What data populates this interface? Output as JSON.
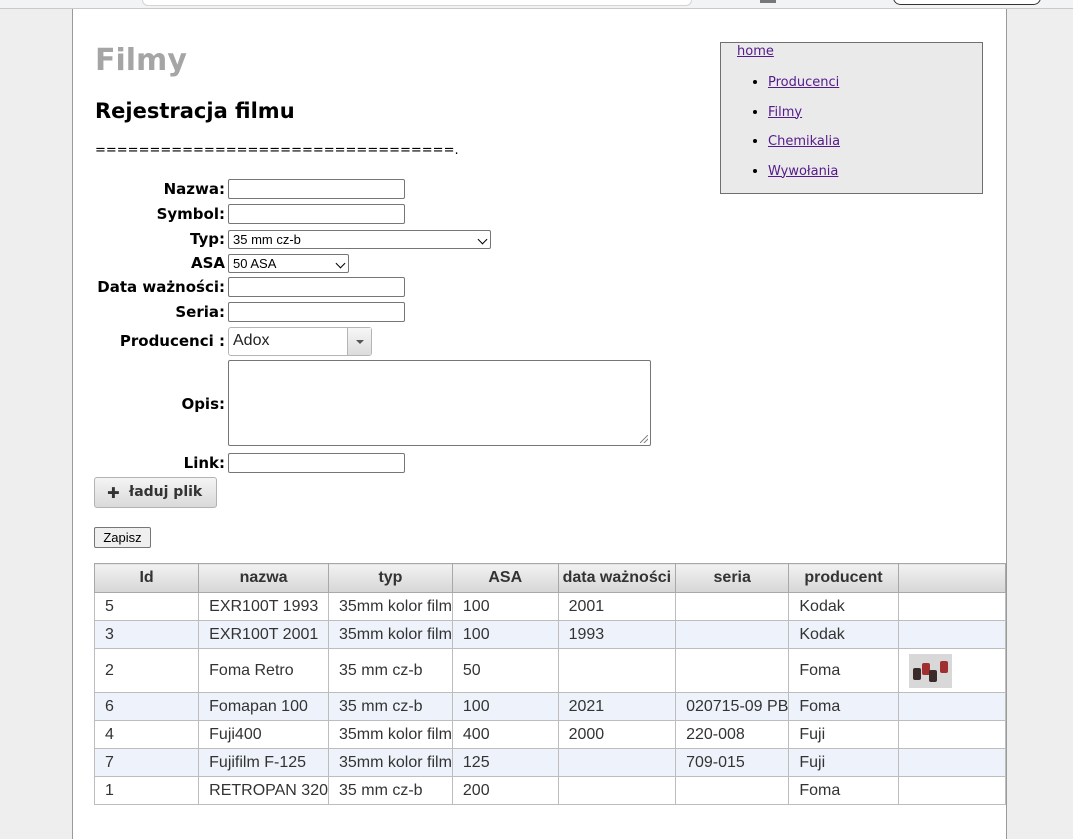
{
  "site_title": "Filmy",
  "form_title": "Rejestracja filmu",
  "separator": "=================================.",
  "nav": {
    "home": "home",
    "items": [
      {
        "label": "Producenci"
      },
      {
        "label": "Filmy"
      },
      {
        "label": "Chemikalia"
      },
      {
        "label": "Wywołania"
      }
    ]
  },
  "form": {
    "nazwa_label": "Nazwa:",
    "symbol_label": "Symbol:",
    "typ_label": "Typ:",
    "typ_value": "35 mm cz-b",
    "asa_label": "ASA",
    "asa_value": "50 ASA",
    "data_label": "Data ważności:",
    "seria_label": "Seria:",
    "producenci_label": "Producenci :",
    "producenci_value": "Adox",
    "opis_label": "Opis:",
    "link_label": "Link:",
    "upload_label": "ładuj plik",
    "submit_label": "Zapisz"
  },
  "table": {
    "headers": [
      "Id",
      "nazwa",
      "typ",
      "ASA",
      "data ważności",
      "seria",
      "producent",
      ""
    ],
    "rows": [
      {
        "id": "5",
        "nazwa": "EXR100T 1993",
        "typ": "35mm kolor film",
        "asa": "100",
        "data": "2001",
        "seria": "",
        "producent": "Kodak",
        "thumb": false
      },
      {
        "id": "3",
        "nazwa": "EXR100T 2001",
        "typ": "35mm kolor film",
        "asa": "100",
        "data": "1993",
        "seria": "",
        "producent": "Kodak",
        "thumb": false
      },
      {
        "id": "2",
        "nazwa": "Foma Retro",
        "typ": "35 mm cz-b",
        "asa": "50",
        "data": "",
        "seria": "",
        "producent": "Foma",
        "thumb": true
      },
      {
        "id": "6",
        "nazwa": "Fomapan 100",
        "typ": "35 mm cz-b",
        "asa": "100",
        "data": "2021",
        "seria": "020715-09 PB",
        "producent": "Foma",
        "thumb": false
      },
      {
        "id": "4",
        "nazwa": "Fuji400",
        "typ": "35mm kolor film",
        "asa": "400",
        "data": "2000",
        "seria": "220-008",
        "producent": "Fuji",
        "thumb": false
      },
      {
        "id": "7",
        "nazwa": "Fujifilm F-125",
        "typ": "35mm kolor film",
        "asa": "125",
        "data": "",
        "seria": "709-015",
        "producent": "Fuji",
        "thumb": false
      },
      {
        "id": "1",
        "nazwa": "RETROPAN 320",
        "typ": "35 mm cz-b",
        "asa": "200",
        "data": "",
        "seria": "",
        "producent": "Foma",
        "thumb": false
      }
    ]
  }
}
